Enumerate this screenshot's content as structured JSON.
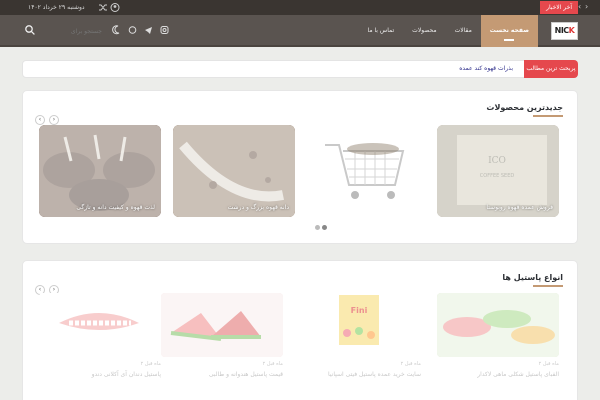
{
  "topbar": {
    "hot_label": "آخر الاخبار",
    "date": "دوشنبه ۲۹ خرداد ۱۴۰۲"
  },
  "header": {
    "logo_text": "NICK",
    "nav": [
      {
        "label": "صفحه نخست"
      },
      {
        "label": "مقالات"
      },
      {
        "label": "محصولات"
      },
      {
        "label": "تماس با ما"
      }
    ],
    "search_placeholder": "جستجو برای"
  },
  "ticker": {
    "label": "پربحث ترین مطالب",
    "text": "بذرات قهوه کند عمده"
  },
  "section_latest": {
    "title": "جدیدترین محصولات",
    "cards": [
      {
        "caption": "فروش عمده قهوه روبوستا"
      },
      {
        "caption": ""
      },
      {
        "caption": "دانه قهوه بزرگ و درشت"
      },
      {
        "caption": "لذت قهوه و کیفیت دانه و تازگی"
      }
    ]
  },
  "section_pastil": {
    "title": "انواع پاستیل ها",
    "cards": [
      {
        "meta": "۲ ماه قبل",
        "title": "الفبای پاستیل شکلی ماهی لاکدار"
      },
      {
        "meta": "۲ ماه قبل",
        "title": "سایت خرید عمده پاستیل فیتی اسپانیا"
      },
      {
        "meta": "۲ ماه قبل",
        "title": "قیمت پاستیل هندوانه و طالبی"
      },
      {
        "meta": "۲ ماه قبل",
        "title": "پاستیل دندان آی آکلانی دندو"
      }
    ]
  },
  "colors": {
    "accent": "#c49a74",
    "hot": "#e5484d",
    "header_bg": "#5a5450",
    "topbar_bg": "#3a3531"
  }
}
